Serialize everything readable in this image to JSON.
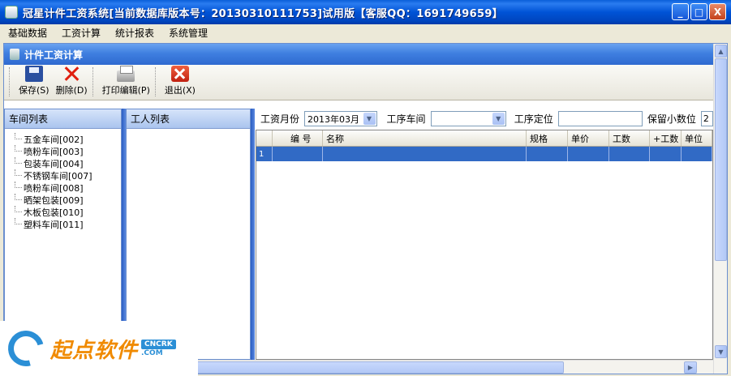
{
  "window": {
    "title": "冠星计件工资系统[当前数据库版本号：20130310111753]试用版【客服QQ：1691749659】",
    "minimize": "_",
    "maximize": "□",
    "close": "X"
  },
  "menu": [
    "基础数据",
    "工资计算",
    "统计报表",
    "系统管理"
  ],
  "inner_title": "计件工资计算",
  "toolbar": {
    "save": "保存(S)",
    "delete": "删除(D)",
    "print": "打印编辑(P)",
    "exit": "退出(X)"
  },
  "workshop_panel": {
    "header": "车间列表",
    "items": [
      "五金车间[002]",
      "喷粉车间[003]",
      "包装车间[004]",
      "不锈钢车间[007]",
      "喷粉车间[008]",
      "晒架包装[009]",
      "木板包装[010]",
      "塑料车间[011]"
    ]
  },
  "worker_panel": {
    "header": "工人列表"
  },
  "filters": {
    "month_label": "工资月份",
    "month_value": "2013年03月",
    "process_workshop_label": "工序车间",
    "process_workshop_value": "",
    "process_locate_label": "工序定位",
    "decimals_label": "保留小数位",
    "decimals_value": "2"
  },
  "grid": {
    "columns": [
      "",
      "编 号",
      "名称",
      "规格",
      "单价",
      "工数",
      "+工数",
      "单位"
    ],
    "rows": [
      [
        "1",
        "",
        "",
        "",
        "",
        "",
        "",
        ""
      ]
    ]
  },
  "watermark": {
    "brand": "起点软件",
    "badge": "CNCRK",
    "domain": ".COM"
  },
  "colors": {
    "titlebar": "#0053d6",
    "selection": "#316ac5",
    "accent": "#f08a00"
  }
}
